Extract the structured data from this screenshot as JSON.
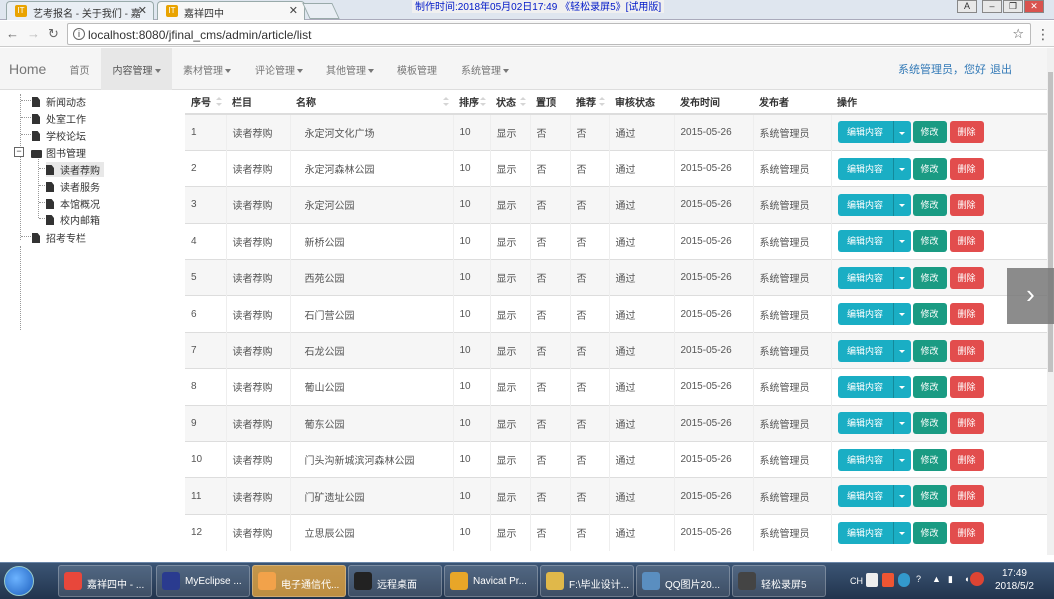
{
  "browser": {
    "tabs": [
      {
        "title": "艺考报名 - 关于我们 - 嘉",
        "favicon": "IT",
        "active": false
      },
      {
        "title": "嘉祥四中",
        "favicon": "IT",
        "active": true
      }
    ],
    "recording_banner": "制作时间:2018年05月02日17:49 《轻松录屏5》[试用版]",
    "url": "localhost:8080/jfinal_cms/admin/article/list"
  },
  "navbar": {
    "brand": "Home",
    "items": [
      {
        "label": "首页",
        "dropdown": false,
        "active": false
      },
      {
        "label": "内容管理",
        "dropdown": true,
        "active": true
      },
      {
        "label": "素材管理",
        "dropdown": true,
        "active": false
      },
      {
        "label": "评论管理",
        "dropdown": true,
        "active": false
      },
      {
        "label": "其他管理",
        "dropdown": true,
        "active": false
      },
      {
        "label": "模板管理",
        "dropdown": false,
        "active": false
      },
      {
        "label": "系统管理",
        "dropdown": true,
        "active": false
      }
    ],
    "user_greeting": "系统管理员，您好",
    "logout": "退出"
  },
  "tree": [
    {
      "label": "新闻动态",
      "level": 1
    },
    {
      "label": "处室工作",
      "level": 1
    },
    {
      "label": "学校论坛",
      "level": 1
    },
    {
      "label": "图书管理",
      "level": 1,
      "folder": true
    },
    {
      "label": "读者荐购",
      "level": 2,
      "selected": true
    },
    {
      "label": "读者服务",
      "level": 2
    },
    {
      "label": "本馆概况",
      "level": 2
    },
    {
      "label": "校内邮箱",
      "level": 2
    },
    {
      "label": "招考专栏",
      "level": 1
    }
  ],
  "table": {
    "columns": [
      "序号",
      "栏目",
      "名称",
      "排序",
      "状态",
      "置顶",
      "推荐",
      "审核状态",
      "发布时间",
      "发布者",
      "操作"
    ],
    "actions": {
      "edit": "编辑内容",
      "modify": "修改",
      "delete": "删除"
    },
    "rows": [
      [
        "1",
        "读者荐购",
        "永定河文化广场",
        "10",
        "显示",
        "否",
        "否",
        "通过",
        "2015-05-26",
        "系统管理员"
      ],
      [
        "2",
        "读者荐购",
        "永定河森林公园",
        "10",
        "显示",
        "否",
        "否",
        "通过",
        "2015-05-26",
        "系统管理员"
      ],
      [
        "3",
        "读者荐购",
        "永定河公园",
        "10",
        "显示",
        "否",
        "否",
        "通过",
        "2015-05-26",
        "系统管理员"
      ],
      [
        "4",
        "读者荐购",
        "新桥公园",
        "10",
        "显示",
        "否",
        "否",
        "通过",
        "2015-05-26",
        "系统管理员"
      ],
      [
        "5",
        "读者荐购",
        "西苑公园",
        "10",
        "显示",
        "否",
        "否",
        "通过",
        "2015-05-26",
        "系统管理员"
      ],
      [
        "6",
        "读者荐购",
        "石门营公园",
        "10",
        "显示",
        "否",
        "否",
        "通过",
        "2015-05-26",
        "系统管理员"
      ],
      [
        "7",
        "读者荐购",
        "石龙公园",
        "10",
        "显示",
        "否",
        "否",
        "通过",
        "2015-05-26",
        "系统管理员"
      ],
      [
        "8",
        "读者荐购",
        "葡山公园",
        "10",
        "显示",
        "否",
        "否",
        "通过",
        "2015-05-26",
        "系统管理员"
      ],
      [
        "9",
        "读者荐购",
        "葡东公园",
        "10",
        "显示",
        "否",
        "否",
        "通过",
        "2015-05-26",
        "系统管理员"
      ],
      [
        "10",
        "读者荐购",
        "门头沟新城滨河森林公园",
        "10",
        "显示",
        "否",
        "否",
        "通过",
        "2015-05-26",
        "系统管理员"
      ],
      [
        "11",
        "读者荐购",
        "门矿遗址公园",
        "10",
        "显示",
        "否",
        "否",
        "通过",
        "2015-05-26",
        "系统管理员"
      ],
      [
        "12",
        "读者荐购",
        "立思辰公园",
        "10",
        "显示",
        "否",
        "否",
        "通过",
        "2015-05-26",
        "系统管理员"
      ]
    ]
  },
  "taskbar": {
    "items": [
      {
        "label": "嘉祥四中 - ...",
        "color": "#e8473b"
      },
      {
        "label": "MyEclipse ...",
        "color": "#2a3b8f"
      },
      {
        "label": "电子通信代...",
        "color": "#f2a24a",
        "highlight": true
      },
      {
        "label": "远程桌面",
        "color": "#222222"
      },
      {
        "label": "Navicat Pr...",
        "color": "#e8a628"
      },
      {
        "label": "F:\\毕业设计...",
        "color": "#e0b84a"
      },
      {
        "label": "QQ图片20...",
        "color": "#5a8ec0"
      },
      {
        "label": "轻松录屏5",
        "color": "#444444"
      }
    ],
    "tray": {
      "lang": "CH",
      "time": "17:49",
      "date": "2018/5/2"
    }
  }
}
